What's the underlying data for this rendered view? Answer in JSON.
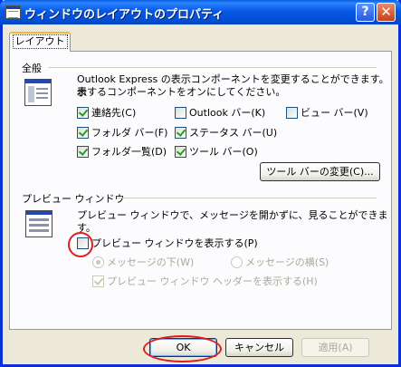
{
  "title": "ウィンドウのレイアウトのプロパティ",
  "title_buttons": {
    "help": "?",
    "close": "✕"
  },
  "tab": {
    "label": "レイアウト"
  },
  "basic": {
    "title": "全般",
    "icon": "window-layout-icon",
    "desc_line1": "Outlook Express の表示コンポーネントを変更することができます。表",
    "desc_line2": "示するコンポーネントをオンにしてください。",
    "checkboxes": [
      {
        "label": "連絡先(C)",
        "checked": true
      },
      {
        "label": "Outlook バー(K)",
        "checked": false
      },
      {
        "label": "ビュー バー(V)",
        "checked": false
      },
      {
        "label": "フォルダ バー(F)",
        "checked": true
      },
      {
        "label": "ステータス バー(U)",
        "checked": true
      },
      {
        "label": "フォルダ一覧(D)",
        "checked": true
      },
      {
        "label": "ツール バー(O)",
        "checked": true
      }
    ],
    "toolbar_button": "ツール バーの変更(C)..."
  },
  "preview": {
    "title": "プレビュー ウィンドウ",
    "icon": "preview-pane-icon",
    "desc": "プレビュー ウィンドウで、メッセージを開かずに、見ることができます。",
    "show_checkbox": {
      "label": "プレビュー ウィンドウを表示する(P)",
      "checked": false
    },
    "radios": [
      {
        "label": "メッセージの下(W)",
        "selected": true
      },
      {
        "label": "メッセージの横(S)",
        "selected": false
      }
    ],
    "header_checkbox": {
      "label": "プレビュー ウィンドウ ヘッダーを表示する(H)",
      "checked": true
    }
  },
  "footer": {
    "ok": "OK",
    "cancel": "キャンセル",
    "apply": "適用(A)"
  },
  "colors": {
    "annotation": "#e01d1d",
    "title_bar": "#0758e6",
    "check": "#21a121"
  }
}
